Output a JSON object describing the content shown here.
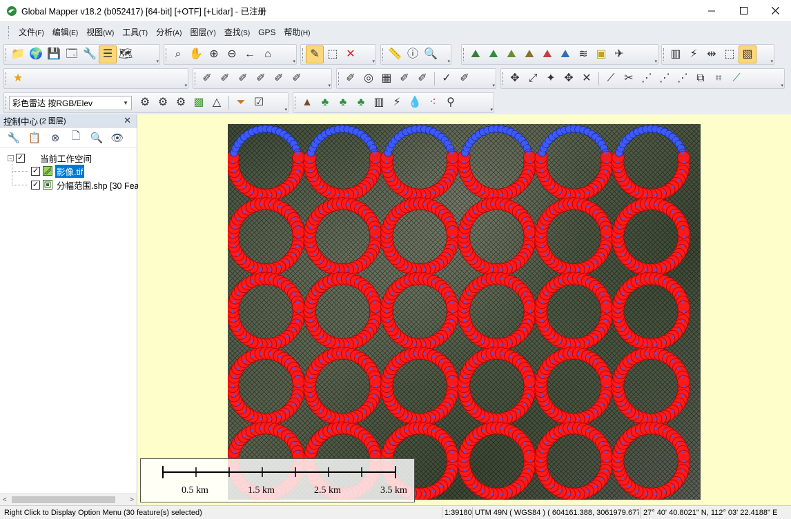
{
  "window": {
    "title": "Global Mapper v18.2 (b052417) [64-bit] [+OTF] [+Lidar] - 已注册",
    "minimize_icon": "minimize-icon",
    "maximize_icon": "maximize-icon",
    "close_icon": "close-icon"
  },
  "menu": [
    {
      "label": "文件",
      "accel": "(F)"
    },
    {
      "label": "编辑",
      "accel": "(E)"
    },
    {
      "label": "视图",
      "accel": "(W)"
    },
    {
      "label": "工具",
      "accel": "(T)"
    },
    {
      "label": "分析",
      "accel": "(A)"
    },
    {
      "label": "图层",
      "accel": "(Y)"
    },
    {
      "label": "查找",
      "accel": "(S)"
    },
    {
      "label": "GPS",
      "accel": ""
    },
    {
      "label": "帮助",
      "accel": "(H)"
    }
  ],
  "toolbar": {
    "shader_select": "彩色雷达 按RGB/Elev"
  },
  "control_center": {
    "title": "控制中心",
    "count": "(2 图层)",
    "workspace_label": "当前工作空间",
    "layers": [
      {
        "label": "影像.tif",
        "checked": true,
        "selected": true
      },
      {
        "label": "分幅范围.shp [30 Fea",
        "checked": true,
        "selected": false
      }
    ]
  },
  "map": {
    "scale_labels": [
      "0.5 km",
      "1.5 km",
      "2.5 km",
      "3.5 km"
    ],
    "grid_rows": 5,
    "grid_cols": 6,
    "ring_color": "#ff1a1a",
    "top_ring_color": "#3d5bff",
    "background": "#fefecb"
  },
  "status": {
    "hint": "Right Click to Display Option Menu (30 feature(s) selected)",
    "scale": "1:39180",
    "projection": "UTM 49N ( WGS84 ) ( 604161.388, 3061979.677 )",
    "latlon": "27° 40' 40.8021\" N, 112° 03' 22.4188\" E"
  }
}
